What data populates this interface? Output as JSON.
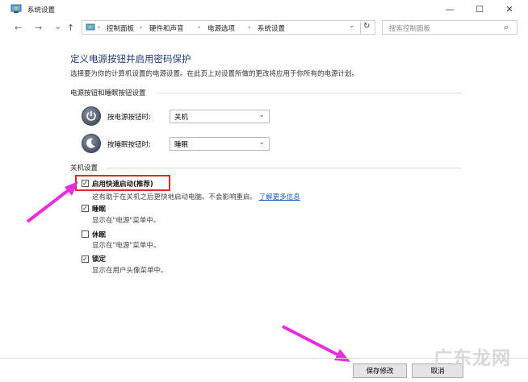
{
  "window": {
    "title": "系统设置",
    "controls": {
      "minimize": "—",
      "maximize": "☐",
      "close": "✕"
    }
  },
  "nav": {
    "back": "←",
    "forward": "→",
    "dropdown": "⌄",
    "up": "↑",
    "breadcrumbs": [
      "控制面板",
      "硬件和声音",
      "电源选项",
      "系统设置"
    ],
    "address_dropdown": "⌄",
    "refresh": "↻",
    "search_placeholder": "搜索控制面板",
    "search_icon": "⌕"
  },
  "content": {
    "heading": "定义电源按钮并启用密码保护",
    "description": "选择要为你的计算机设置的电源设置。在此页上对设置所做的更改将应用于你所有的电源计划。",
    "power_section": {
      "title": "电源按钮和睡眠按钮设置",
      "rows": [
        {
          "label": "按电源按钮时:",
          "value": "关机",
          "icon": "power-icon"
        },
        {
          "label": "按睡眠按钮时:",
          "value": "睡眠",
          "icon": "moon-icon"
        }
      ]
    },
    "shutdown_section": {
      "title": "关机设置",
      "items": [
        {
          "label": "启用快速启动(推荐)",
          "checked": true,
          "desc": "这有助于在关机之后更快地启动电脑。不会影响重启。",
          "link": "了解更多信息"
        },
        {
          "label": "睡眠",
          "checked": true,
          "desc": "显示在\"电源\"菜单中。"
        },
        {
          "label": "休眠",
          "checked": false,
          "desc": "显示在\"电源\"菜单中。"
        },
        {
          "label": "锁定",
          "checked": true,
          "desc": "显示在用户头像菜单中。"
        }
      ]
    }
  },
  "buttons": {
    "save": "保存修改",
    "cancel": "取消"
  },
  "watermark": "广东龙网",
  "colors": {
    "heading": "#1e3c78",
    "link": "#1a5bbf",
    "highlight_box": "#e0282d",
    "arrow": "#e82de0"
  }
}
